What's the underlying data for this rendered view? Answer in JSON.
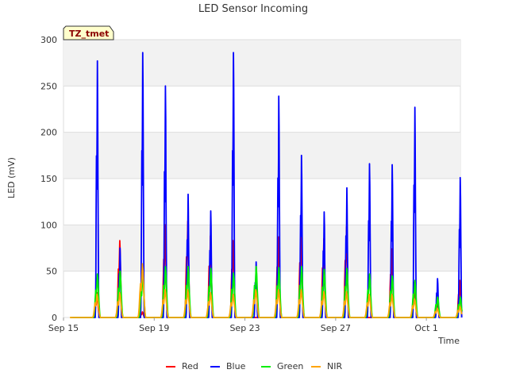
{
  "chart_data": {
    "type": "line",
    "title": "LED Sensor Incoming",
    "xlabel": "Time",
    "ylabel": "LED (mV)",
    "ylim": [
      0,
      300
    ],
    "yticks": [
      0,
      50,
      100,
      150,
      200,
      250,
      300
    ],
    "xlim": [
      "2023-09-15",
      "2023-10-02 12:00"
    ],
    "xticks": [
      {
        "date": "2023-09-15",
        "label": "Sep 15"
      },
      {
        "date": "2023-09-19",
        "label": "Sep 19"
      },
      {
        "date": "2023-09-23",
        "label": "Sep 23"
      },
      {
        "date": "2023-09-27",
        "label": "Sep 27"
      },
      {
        "date": "2023-10-01",
        "label": "Oct 1"
      }
    ],
    "tag": "TZ_tmet",
    "grid": true,
    "legend_position": "bottom",
    "days": [
      "2023-09-15",
      "2023-09-16",
      "2023-09-17",
      "2023-09-18",
      "2023-09-19",
      "2023-09-20",
      "2023-09-21",
      "2023-09-22",
      "2023-09-23",
      "2023-09-24",
      "2023-09-25",
      "2023-09-26",
      "2023-09-27",
      "2023-09-28",
      "2023-09-29",
      "2023-09-30",
      "2023-10-01",
      "2023-10-02"
    ],
    "series": [
      {
        "name": "Red",
        "color": "#ff0000",
        "peaks": [
          0,
          27,
          83,
          6,
          100,
          104,
          88,
          83,
          0,
          87,
          94,
          85,
          98,
          0,
          74,
          38,
          15,
          40
        ]
      },
      {
        "name": "Blue",
        "color": "#0000ff",
        "peaks": [
          0,
          277,
          75,
          286,
          250,
          133,
          115,
          286,
          60,
          239,
          175,
          114,
          140,
          166,
          165,
          227,
          42,
          151
        ]
      },
      {
        "name": "Green",
        "color": "#00ee00",
        "peaks": [
          0,
          47,
          50,
          47,
          55,
          55,
          53,
          48,
          55,
          54,
          55,
          52,
          53,
          47,
          45,
          40,
          22,
          22
        ]
      },
      {
        "name": "NIR",
        "color": "#ffa500",
        "peaks": [
          0,
          25,
          27,
          58,
          30,
          30,
          27,
          25,
          30,
          30,
          30,
          28,
          28,
          25,
          25,
          20,
          10,
          12
        ]
      }
    ]
  }
}
